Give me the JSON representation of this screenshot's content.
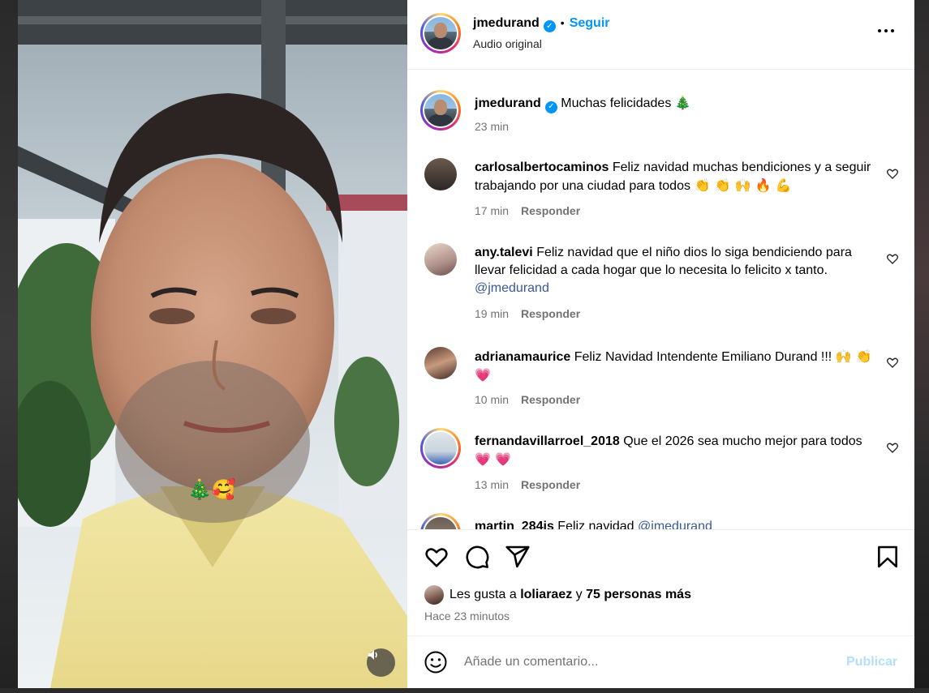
{
  "header": {
    "username": "jmedurand",
    "separator": "•",
    "follow_label": "Seguir",
    "subtitle": "Audio original"
  },
  "caption": {
    "username": "jmedurand",
    "text": "Muchas felicidades",
    "emoji": "🎄",
    "time": "23 min"
  },
  "comments": [
    {
      "username": "carlosalbertocaminos",
      "text": "Feliz navidad muchas bendiciones y a seguir trabajando por una ciudad para todos",
      "emoji": "👏 👏 🙌 🔥 💪",
      "time": "17 min",
      "reply": "Responder"
    },
    {
      "username": "any.talevi",
      "text": "Feliz navidad que el niño dios lo siga bendiciendo para llevar felicidad a cada hogar que lo necesita lo felicito x tanto.",
      "mention": "@jmedurand",
      "time": "19 min",
      "reply": "Responder"
    },
    {
      "username": "adrianamaurice",
      "text": "Feliz Navidad Intendente Emiliano Durand !!!",
      "emoji": "🙌 👏 💗",
      "time": "10 min",
      "reply": "Responder"
    },
    {
      "username": "fernandavillarroel_2018",
      "text": "Que el 2026 sea mucho mejor para todos",
      "emoji": "💗 💗",
      "time": "13 min",
      "reply": "Responder"
    },
    {
      "username": "martin_284js",
      "text": "Feliz navidad",
      "mention": "@jmedurand"
    }
  ],
  "likes": {
    "prefix": "Les gusta a",
    "user": "loliaraez",
    "joiner": "y",
    "others": "75 personas más",
    "time": "Hace 23 minutos"
  },
  "add_comment": {
    "placeholder": "Añade un comentario...",
    "publish_label": "Publicar"
  },
  "video": {
    "sticker": "🎄🥰"
  },
  "colors": {
    "accent": "#0095f6",
    "publish_disabled": "#b2dffc",
    "muted": "#737373",
    "mention": "#385898"
  },
  "icons": [
    "more-options-icon",
    "heart-icon",
    "comment-icon",
    "share-icon",
    "bookmark-icon",
    "emoji-icon",
    "sound-icon",
    "verified-badge-icon"
  ]
}
